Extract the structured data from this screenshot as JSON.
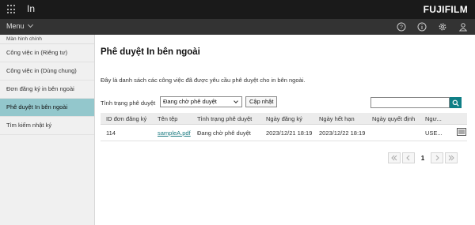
{
  "app": {
    "title": "In",
    "brand": "FUJIFILM"
  },
  "menubar": {
    "menu_label": "Menu"
  },
  "sidebar": {
    "header": "Màn hình chính",
    "items": [
      {
        "label": "Công việc in (Riêng tư)"
      },
      {
        "label": "Công việc in (Dùng chung)"
      },
      {
        "label": "Đơn đăng ký in bên ngoài"
      },
      {
        "label": "Phê duyệt In bên ngoài"
      },
      {
        "label": "Tìm kiếm nhật ký"
      }
    ]
  },
  "main": {
    "title": "Phê duyệt In bên ngoài",
    "description": "Đây là danh sách các công việc đã được yêu cầu phê duyệt cho in bên ngoài.",
    "filter": {
      "label": "Tình trạng phê duyệt",
      "selected": "Đang chờ phê duyệt",
      "update_label": "Cập nhật"
    },
    "table": {
      "headers": [
        "ID đơn đăng ký",
        "Tên tệp",
        "Tình trạng phê duyệt",
        "Ngày đăng ký",
        "Ngày hết hạn",
        "Ngày quyết định",
        "Ngư..."
      ],
      "rows": [
        {
          "id": "114",
          "file": "sampleA.pdf",
          "status": "Đang chờ phê duyệt",
          "registered": "2023/12/21 18:19",
          "expires": "2023/12/22 18:19",
          "decided": "",
          "user": "USE..."
        }
      ]
    },
    "pagination": {
      "current_page": "1"
    }
  },
  "icons": {
    "apps": "apps-grid-icon",
    "help": "help-icon",
    "info": "info-icon",
    "settings": "gear-icon",
    "user": "user-icon",
    "search": "search-icon",
    "detail": "detail-list-icon"
  },
  "colors": {
    "topbar": "#1a1a1a",
    "menubar": "#333333",
    "active_item": "#93c7cc",
    "accent": "#0f7f86"
  }
}
